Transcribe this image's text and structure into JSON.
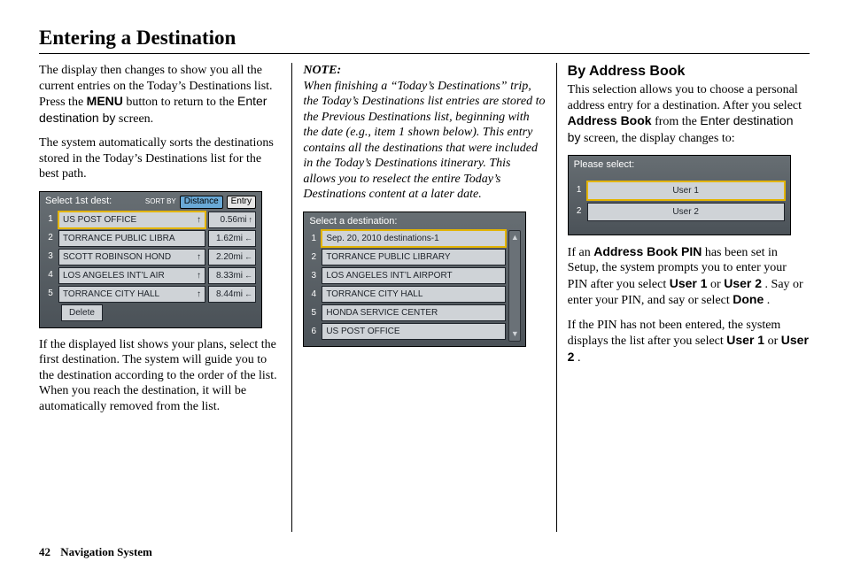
{
  "page_title": "Entering a Destination",
  "footer": {
    "page_number": "42",
    "section_name": "Navigation System"
  },
  "left": {
    "p1_a": "The display then changes to show you all the current entries on the Today’s Destinations list. Press the ",
    "p1_menu": "MENU",
    "p1_b": " button to return to the ",
    "p1_enter_by": "Enter destination by",
    "p1_c": " screen.",
    "p2": "The system automatically sorts the destinations stored in the Today’s Destinations list for the best path.",
    "screen1": {
      "title": "Select 1st dest:",
      "sort_label": "SORT BY",
      "sort_distance": "Distance",
      "sort_entry": "Entry",
      "rows": [
        {
          "num": "1",
          "name": "US POST OFFICE",
          "dist": "0.56mi",
          "arrow": "↑"
        },
        {
          "num": "2",
          "name": "TORRANCE PUBLIC LIBRA",
          "dist": "1.62mi",
          "arrow": "←"
        },
        {
          "num": "3",
          "name": "SCOTT ROBINSON HOND",
          "dist": "2.20mi",
          "arrow": "←"
        },
        {
          "num": "4",
          "name": "LOS ANGELES INT’L AIR",
          "dist": "8.33mi",
          "arrow": "←"
        },
        {
          "num": "5",
          "name": "TORRANCE CITY HALL",
          "dist": "8.44mi",
          "arrow": "←"
        }
      ],
      "delete_label": "Delete"
    },
    "p3": "If the displayed list shows your plans, select the first destination. The system will guide you to the destination according to the order of the list. When you reach the destination, it will be automatically removed from the list."
  },
  "middle": {
    "note_label": "NOTE:",
    "note_body": "When finishing a “Today’s Destinations” trip, the Today’s Destinations list entries are stored to the Previous Destinations list, beginning with the date (e.g., item 1 shown below). This entry contains all the destinations that were included in the Today’s Destinations itinerary. This allows you to reselect the entire Today’s Destinations content at a later date.",
    "screen2": {
      "title": "Select a destination:",
      "rows": [
        {
          "num": "1",
          "name": "Sep. 20, 2010 destinations-1"
        },
        {
          "num": "2",
          "name": "TORRANCE PUBLIC LIBRARY"
        },
        {
          "num": "3",
          "name": "LOS ANGELES INT’L AIRPORT"
        },
        {
          "num": "4",
          "name": "TORRANCE CITY HALL"
        },
        {
          "num": "5",
          "name": "HONDA SERVICE CENTER"
        },
        {
          "num": "6",
          "name": "US POST OFFICE"
        }
      ]
    }
  },
  "right": {
    "heading": "By Address Book",
    "p1_a": "This selection allows you to choose a personal address entry for a destination. After you select ",
    "p1_ab": "Address Book",
    "p1_b": " from the ",
    "p1_enter_by": "Enter destination by",
    "p1_c": " screen, the display changes to:",
    "screen3": {
      "title": "Please select:",
      "items": [
        {
          "num": "1",
          "label": "User 1"
        },
        {
          "num": "2",
          "label": "User 2"
        }
      ]
    },
    "p2_a": "If an ",
    "p2_pin": "Address Book PIN",
    "p2_b": " has been set in Setup, the system prompts you to enter your PIN after you select ",
    "p2_u1": "User 1",
    "p2_c": " or ",
    "p2_u2": "User 2",
    "p2_d": ". Say or enter your PIN, and say or select ",
    "p2_done": "Done",
    "p2_e": ".",
    "p3_a": "If the PIN has not been entered, the system displays the list after you select ",
    "p3_u1": "User 1",
    "p3_b": " or ",
    "p3_u2": "User 2",
    "p3_c": "."
  }
}
